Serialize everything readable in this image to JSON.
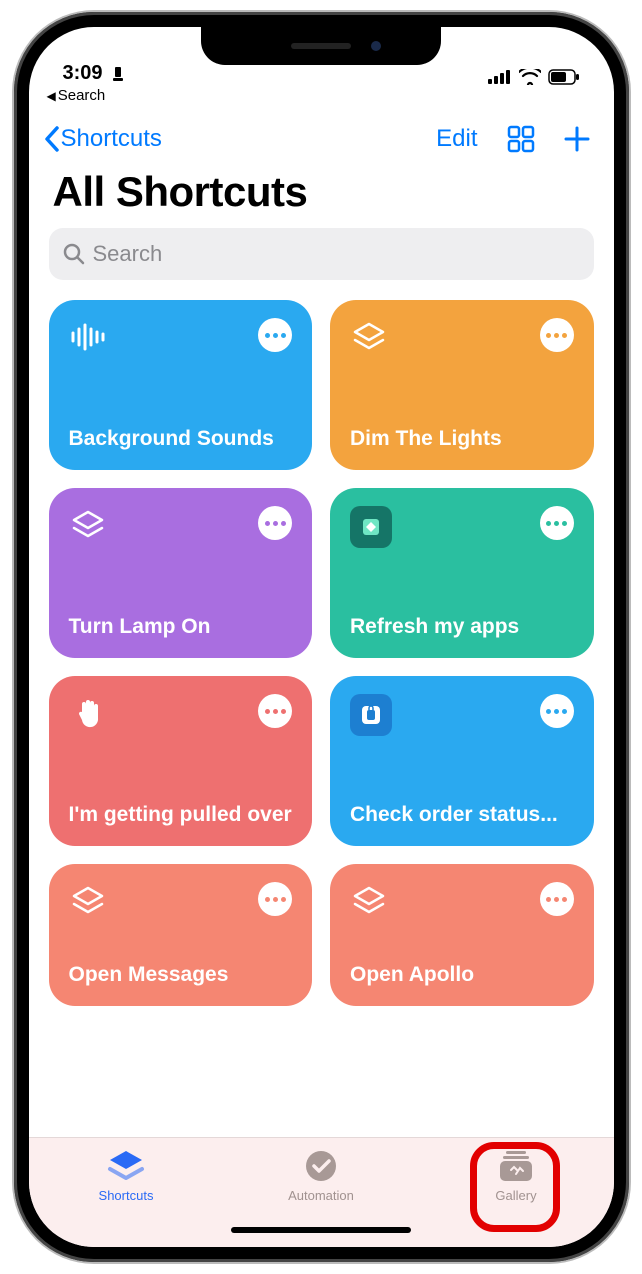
{
  "status": {
    "time": "3:09",
    "back_app": "Search"
  },
  "nav": {
    "back_label": "Shortcuts",
    "edit": "Edit"
  },
  "title": "All Shortcuts",
  "search": {
    "placeholder": "Search"
  },
  "cards": [
    {
      "label": "Background Sounds",
      "icon": "waveform-icon",
      "color": "#2aa9f0"
    },
    {
      "label": "Dim The Lights",
      "icon": "layers-icon",
      "color": "#f3a33e"
    },
    {
      "label": "Turn Lamp On",
      "icon": "layers-icon",
      "color": "#a96ee0"
    },
    {
      "label": "Refresh my apps",
      "icon": "diamond-icon",
      "color": "#2abfa0"
    },
    {
      "label": "I'm getting pulled over",
      "icon": "hand-icon",
      "color": "#ee7070"
    },
    {
      "label": "Check order status...",
      "icon": "appstore-icon",
      "color": "#2aa9f0"
    },
    {
      "label": "Open Messages",
      "icon": "layers-icon",
      "color": "#f58672"
    },
    {
      "label": "Open Apollo",
      "icon": "layers-icon",
      "color": "#f58672"
    }
  ],
  "tabs": {
    "shortcuts": "Shortcuts",
    "automation": "Automation",
    "gallery": "Gallery",
    "active": "shortcuts",
    "highlighted": "gallery"
  }
}
